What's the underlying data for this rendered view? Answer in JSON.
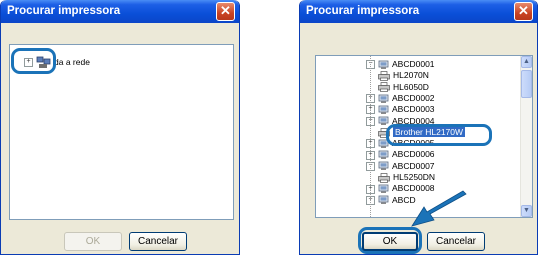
{
  "left_dialog": {
    "title": "Procurar impressora",
    "close_glyph": "✕",
    "tree_root_label": "da a rede",
    "ok_label": "OK",
    "cancel_label": "Cancelar"
  },
  "right_dialog": {
    "title": "Procurar impressora",
    "close_glyph": "✕",
    "tree": [
      {
        "label": "ABCD0001",
        "kind": "computer",
        "expander": "−"
      },
      {
        "label": "HL2070N",
        "kind": "printer"
      },
      {
        "label": "HL6050D",
        "kind": "printer"
      },
      {
        "label": "ABCD0002",
        "kind": "computer",
        "expander": "+"
      },
      {
        "label": "ABCD0003",
        "kind": "computer",
        "expander": "+"
      },
      {
        "label": "ABCD0004",
        "kind": "computer",
        "expander": "−"
      },
      {
        "label": "Brother HL2170W",
        "kind": "printer",
        "selected": true
      },
      {
        "label": "ABCD0005",
        "kind": "computer",
        "expander": "+"
      },
      {
        "label": "ABCD0006",
        "kind": "computer",
        "expander": "+"
      },
      {
        "label": "ABCD0007",
        "kind": "computer",
        "expander": "−"
      },
      {
        "label": "HL5250DN",
        "kind": "printer"
      },
      {
        "label": "ABCD0008",
        "kind": "computer",
        "expander": "+"
      },
      {
        "label": "ABCD",
        "kind": "computer",
        "expander": "+"
      }
    ],
    "scroll_up_glyph": "▲",
    "scroll_down_glyph": "▼",
    "ok_label": "OK",
    "cancel_label": "Cancelar"
  },
  "colors": {
    "callout": "#1b73b8",
    "arrow": "#1b73b8",
    "titlebar": "#0a4fd8",
    "selection": "#316ac5"
  }
}
